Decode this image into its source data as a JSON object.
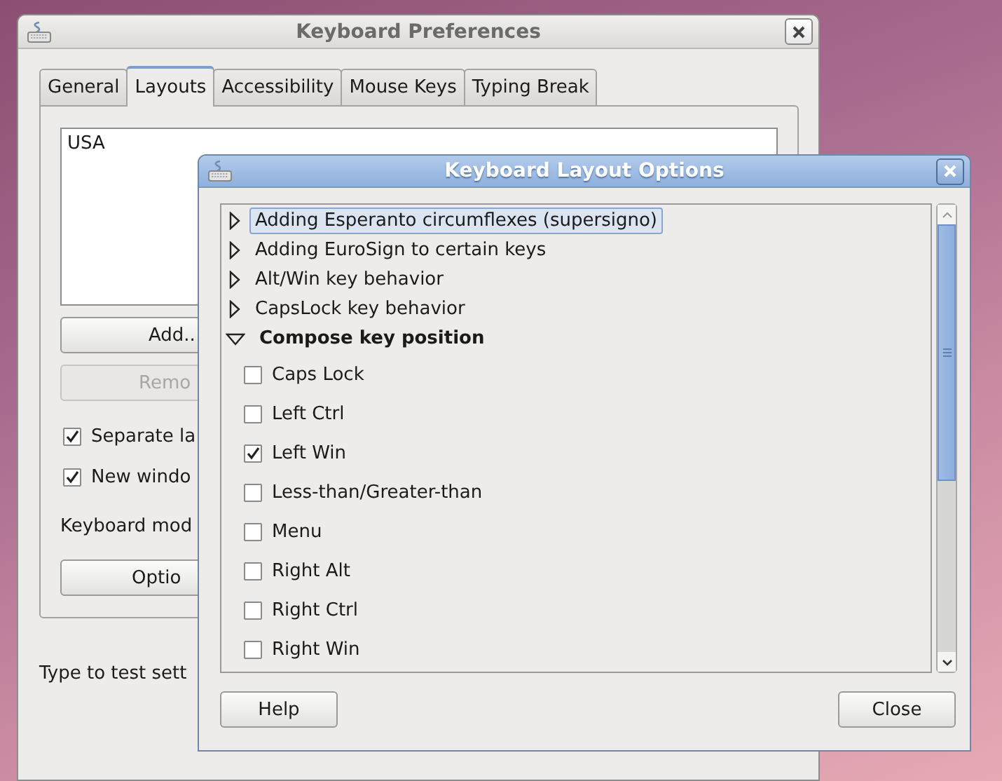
{
  "preferences_window": {
    "title": "Keyboard Preferences",
    "tabs": [
      {
        "label": "General",
        "selected": false
      },
      {
        "label": "Layouts",
        "selected": true
      },
      {
        "label": "Accessibility",
        "selected": false
      },
      {
        "label": "Mouse Keys",
        "selected": false
      },
      {
        "label": "Typing Break",
        "selected": false
      }
    ],
    "layouts": [
      "USA"
    ],
    "buttons": [
      {
        "label": "Add..",
        "disabled": false
      },
      {
        "label": "Remo",
        "disabled": true
      }
    ],
    "checkboxes": [
      {
        "label": "Separate la",
        "checked": true
      },
      {
        "label": "New windo",
        "checked": true
      }
    ],
    "keyboard_model_label": "Keyboard mod",
    "options_button": "Optio",
    "test_label": "Type to test sett"
  },
  "options_dialog": {
    "title": "Keyboard Layout Options",
    "groups": [
      {
        "label": "Adding Esperanto circumflexes (supersigno)",
        "expanded": false,
        "selected": true
      },
      {
        "label": "Adding EuroSign to certain keys",
        "expanded": false,
        "selected": false
      },
      {
        "label": "Alt/Win key behavior",
        "expanded": false,
        "selected": false
      },
      {
        "label": "CapsLock key behavior",
        "expanded": false,
        "selected": false
      },
      {
        "label": "Compose key position",
        "expanded": true,
        "selected": false,
        "children": [
          {
            "label": "Caps Lock",
            "checked": false
          },
          {
            "label": "Left Ctrl",
            "checked": false
          },
          {
            "label": "Left Win",
            "checked": true
          },
          {
            "label": "Less-than/Greater-than",
            "checked": false
          },
          {
            "label": "Menu",
            "checked": false
          },
          {
            "label": "Right Alt",
            "checked": false
          },
          {
            "label": "Right Ctrl",
            "checked": false
          },
          {
            "label": "Right Win",
            "checked": false
          }
        ]
      }
    ],
    "buttons": [
      "Help",
      "Close"
    ]
  }
}
